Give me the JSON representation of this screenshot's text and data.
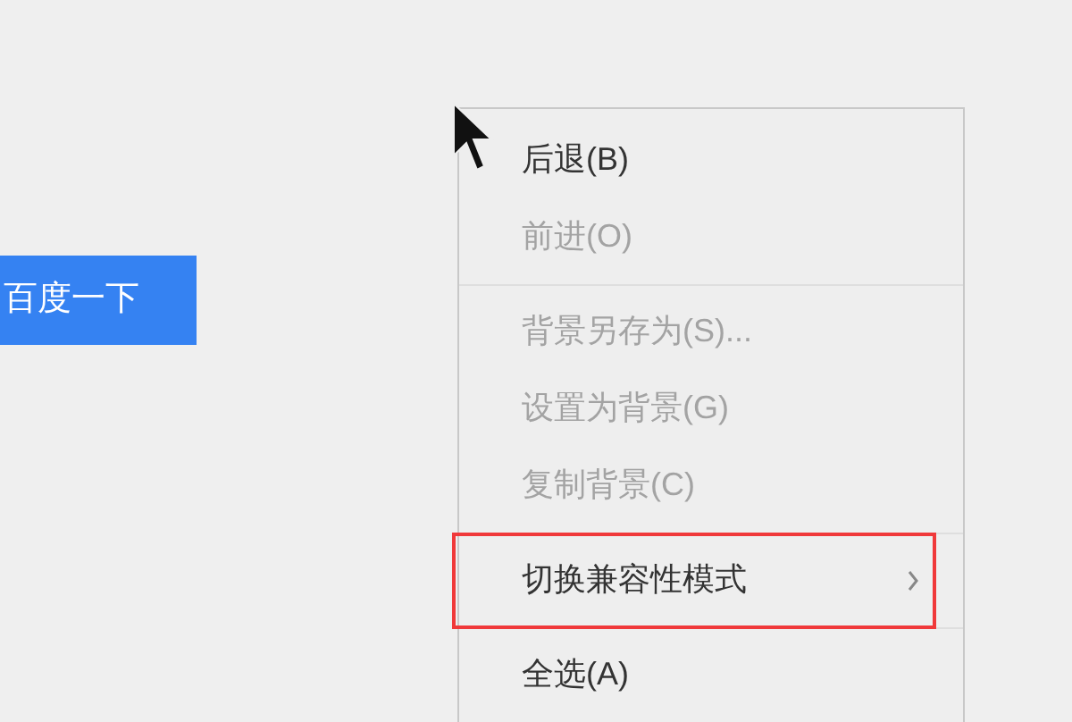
{
  "search_button": {
    "label": "百度一下"
  },
  "context_menu": {
    "items": [
      {
        "kind": "item",
        "label": "后退(B)",
        "disabled": false,
        "submenu": false,
        "highlighted": false
      },
      {
        "kind": "item",
        "label": "前进(O)",
        "disabled": true,
        "submenu": false,
        "highlighted": false
      },
      {
        "kind": "separator"
      },
      {
        "kind": "item",
        "label": "背景另存为(S)...",
        "disabled": true,
        "submenu": false,
        "highlighted": false
      },
      {
        "kind": "item",
        "label": "设置为背景(G)",
        "disabled": true,
        "submenu": false,
        "highlighted": false
      },
      {
        "kind": "item",
        "label": "复制背景(C)",
        "disabled": true,
        "submenu": false,
        "highlighted": false
      },
      {
        "kind": "separator"
      },
      {
        "kind": "item",
        "label": "切换兼容性模式",
        "disabled": false,
        "submenu": true,
        "highlighted": true
      },
      {
        "kind": "separator"
      },
      {
        "kind": "item",
        "label": "全选(A)",
        "disabled": false,
        "submenu": false,
        "highlighted": false
      }
    ]
  }
}
